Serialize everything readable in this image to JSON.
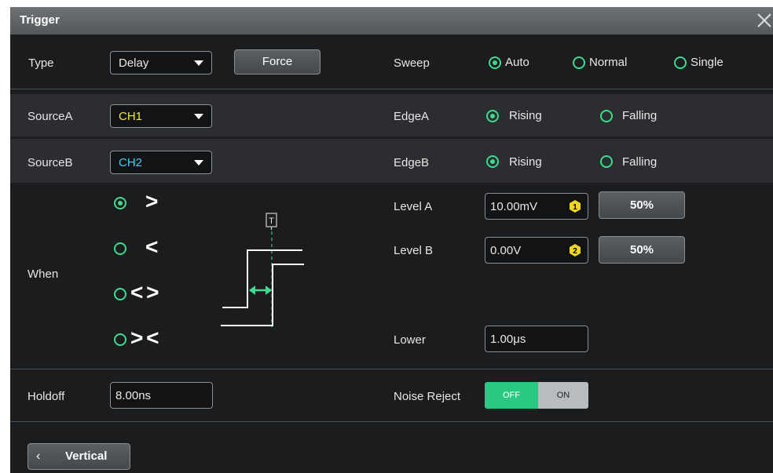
{
  "dialog": {
    "title": "Trigger"
  },
  "type": {
    "label": "Type",
    "value": "Delay"
  },
  "force_label": "Force",
  "sweep": {
    "label": "Sweep",
    "options": [
      "Auto",
      "Normal",
      "Single"
    ],
    "selected": "Auto"
  },
  "source_a": {
    "label": "SourceA",
    "value": "CH1",
    "color": "#f5e63a"
  },
  "source_b": {
    "label": "SourceB",
    "value": "CH2",
    "color": "#3ad2f5"
  },
  "edge_a": {
    "label": "EdgeA",
    "options": [
      "Rising",
      "Falling"
    ],
    "selected": "Rising"
  },
  "edge_b": {
    "label": "EdgeB",
    "options": [
      "Rising",
      "Falling"
    ],
    "selected": "Rising"
  },
  "when": {
    "label": "When",
    "options": [
      ">",
      "<",
      "< >",
      "> <"
    ],
    "selected": ">"
  },
  "diagram": {
    "marker": "T"
  },
  "level_a": {
    "label": "Level A",
    "value": "10.00mV",
    "badge": "1",
    "button": "50%"
  },
  "level_b": {
    "label": "Level B",
    "value": "0.00V",
    "badge": "2",
    "button": "50%"
  },
  "lower": {
    "label": "Lower",
    "value": "1.00μs"
  },
  "holdoff": {
    "label": "Holdoff",
    "value": "8.00ns"
  },
  "noise_reject": {
    "label": "Noise Reject",
    "off": "OFF",
    "on": "ON",
    "state": "OFF"
  },
  "nav": {
    "back_label": "Vertical",
    "back_icon": "‹"
  },
  "colors": {
    "accent": "#3ddb8f",
    "badge": "#f2d81d"
  }
}
